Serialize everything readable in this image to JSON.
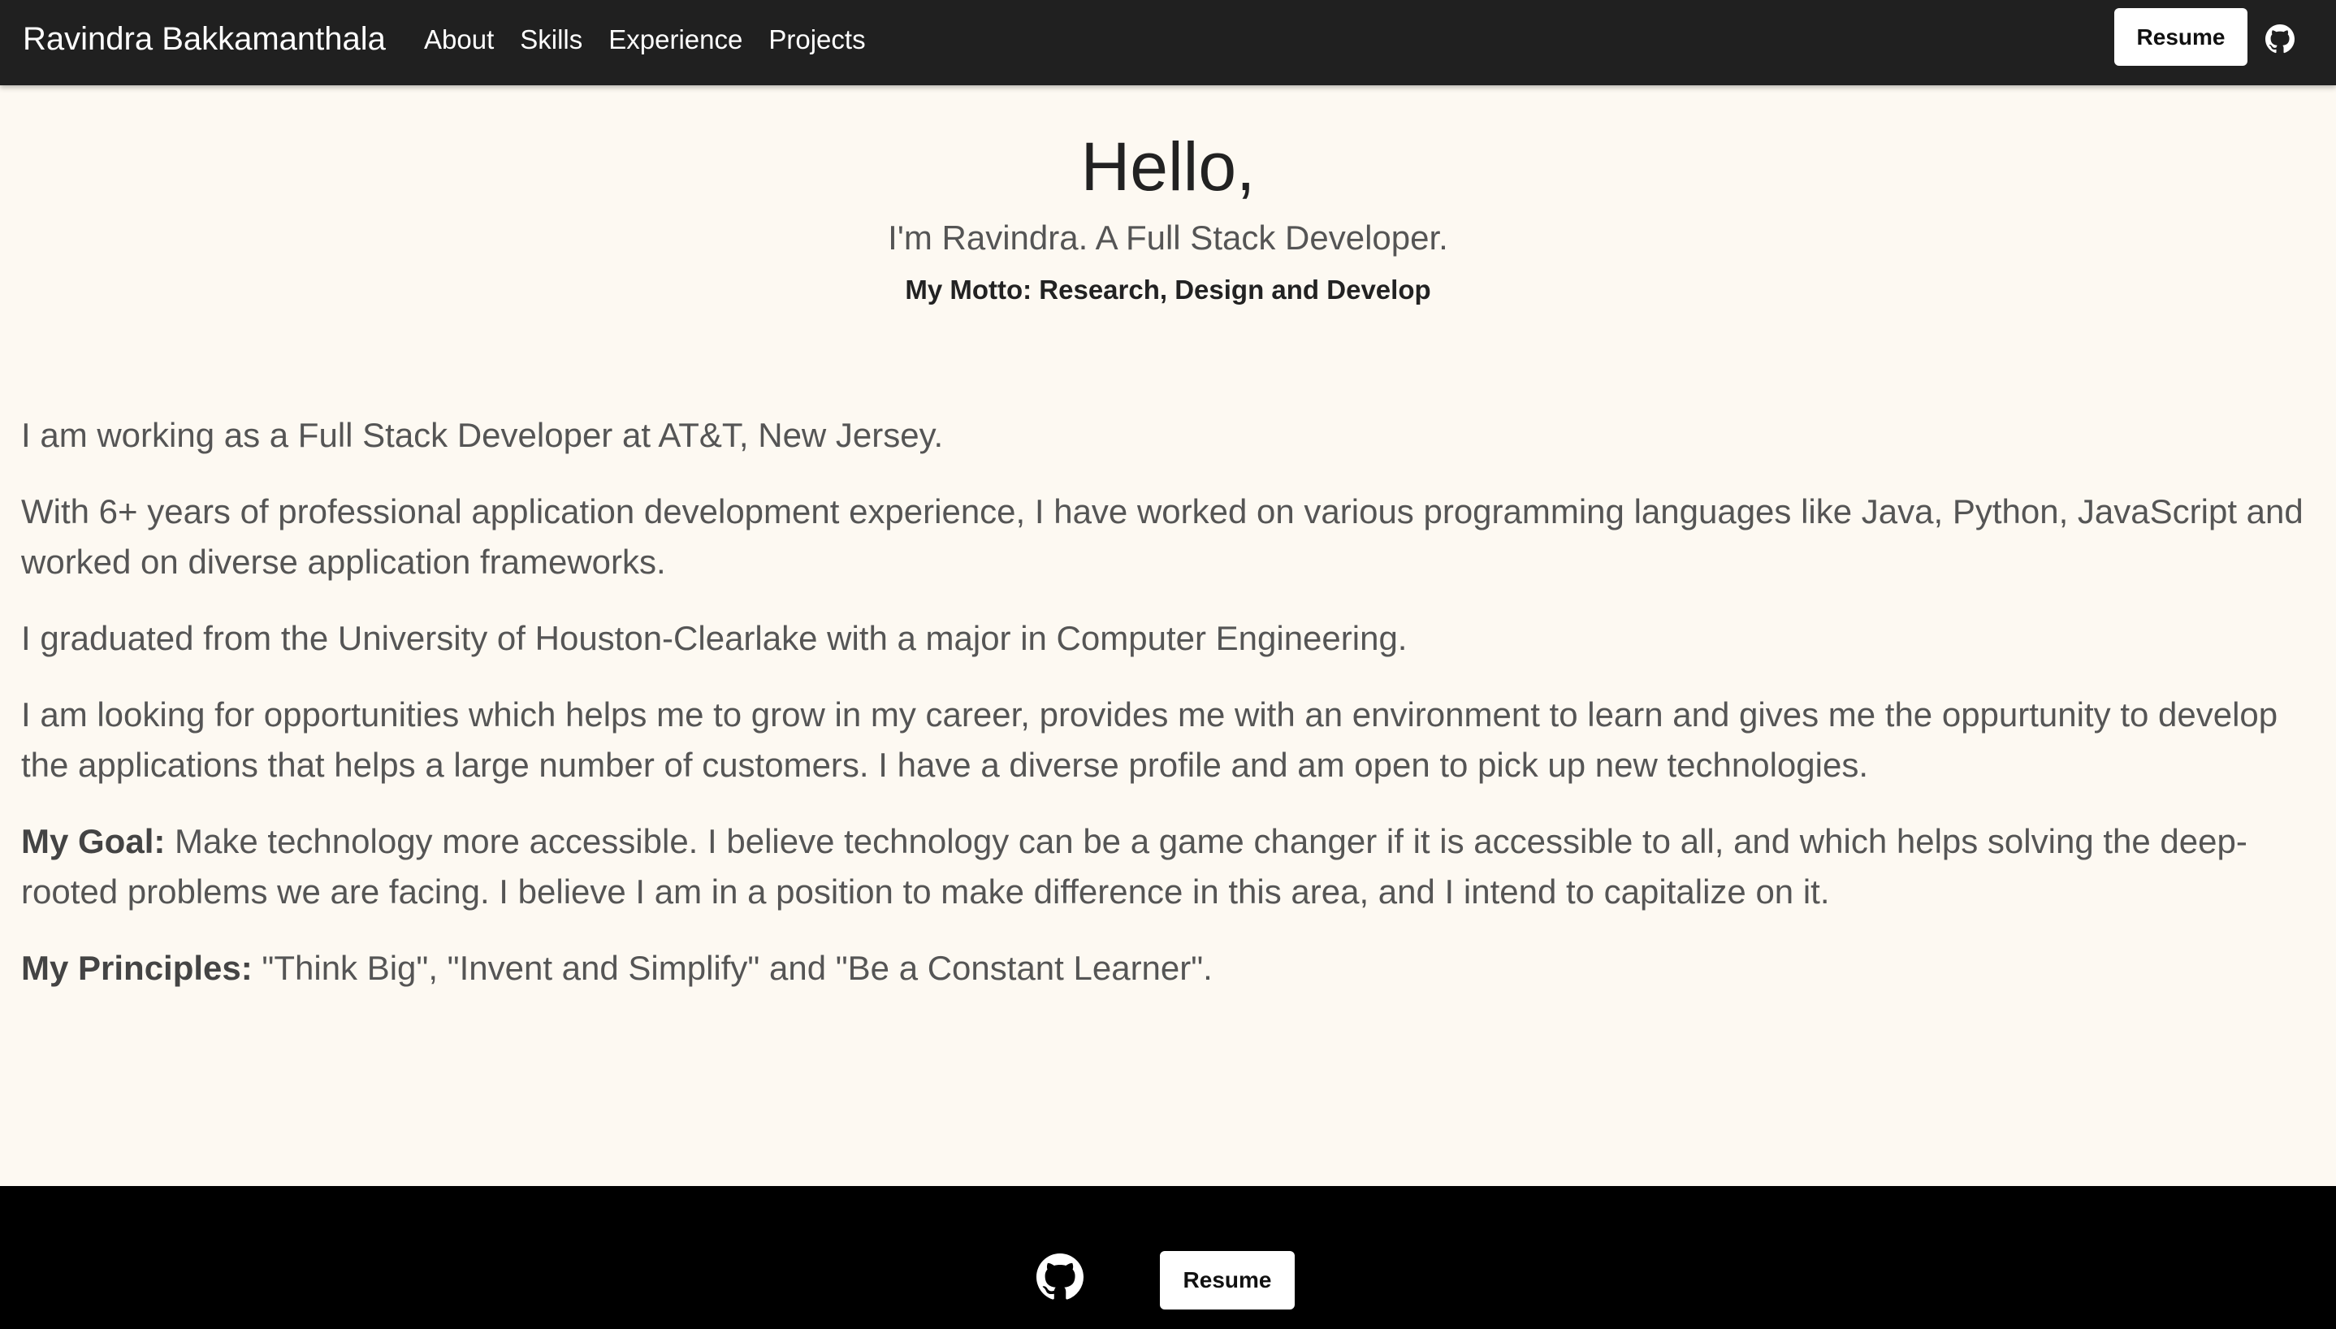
{
  "header": {
    "brand": "Ravindra Bakkamanthala",
    "nav": [
      "About",
      "Skills",
      "Experience",
      "Projects"
    ],
    "resume_label": "Resume",
    "github_icon": "github-icon"
  },
  "hero": {
    "title": "Hello,",
    "subtitle": "I'm Ravindra. A Full Stack Developer.",
    "motto": "My Motto: Research, Design and Develop"
  },
  "about": {
    "p1": "I am working as a Full Stack Developer at AT&T, New Jersey.",
    "p2": "With 6+ years of professional application development experience, I have worked on various programming languages like Java, Python, JavaScript and worked on diverse application frameworks.",
    "p3": "I graduated from the University of Houston-Clearlake with a major in Computer Engineering.",
    "p4": "I am looking for opportunities which helps me to grow in my career, provides me with an environment to learn and gives me the oppurtunity to develop the applications that helps a large number of customers. I have a diverse profile and am open to pick up new technologies.",
    "goal_label": "My Goal:",
    "goal_text": " Make technology more accessible. I believe technology can be a game changer if it is accessible to all, and which helps solving the deep-rooted problems we are facing. I believe I am in a position to make difference in this area, and I intend to capitalize on it.",
    "principles_label": "My Principles:",
    "principles_text": " \"Think Big\", \"Invent and Simplify\" and \"Be a Constant Learner\"."
  },
  "footer": {
    "resume_label": "Resume",
    "github_icon": "github-icon"
  },
  "colors": {
    "navbar_bg": "#202020",
    "page_bg": "#fdf9f2",
    "footer_bg": "#000000",
    "text": "#555555"
  }
}
